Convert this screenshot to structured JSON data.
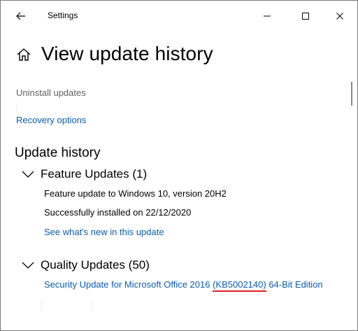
{
  "window": {
    "title": "Settings",
    "controls": [
      "minimize",
      "maximize",
      "close"
    ]
  },
  "page": {
    "title": "View update history",
    "home_icon": "home-icon"
  },
  "links": {
    "uninstall": "Uninstall updates",
    "recovery": "Recovery options"
  },
  "history": {
    "section_title": "Update history",
    "groups": [
      {
        "label": "Feature Updates (1)",
        "entries": [
          "Feature update to Windows 10, version 20H2",
          "Successfully installed on 22/12/2020"
        ],
        "link": "See what's new in this update"
      },
      {
        "label": "Quality Updates (50)",
        "item": {
          "prefix": "Security Update for Microsoft Office 2016 ",
          "kb": "(KB5002140)",
          "suffix": " 64-Bit Edition"
        }
      }
    ]
  },
  "colors": {
    "link": "#0b5cad",
    "secondary_text": "#606060",
    "highlight_underline": "#e02020"
  }
}
